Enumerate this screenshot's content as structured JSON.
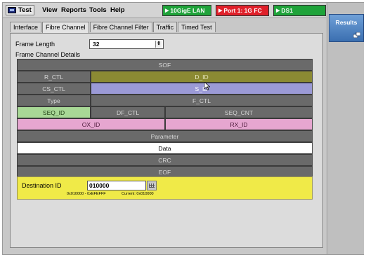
{
  "menu": {
    "test": "Test",
    "view": "View",
    "reports": "Reports",
    "tools": "Tools",
    "help": "Help"
  },
  "status": {
    "lan": "10GigE LAN",
    "port": "Port 1: 1G FC",
    "ds1": "DS1",
    "colors": {
      "green": "#1fa33a",
      "red": "#e0202a"
    }
  },
  "results": {
    "label": "Results"
  },
  "tabs": [
    "Interface",
    "Fibre Channel",
    "Fibre Channel Filter",
    "Traffic",
    "Timed Test"
  ],
  "active_tab": "Fibre Channel",
  "frame_length": {
    "label": "Frame Length",
    "value": "32"
  },
  "details_label": "Frame Channel Details",
  "frame": {
    "sof": "SOF",
    "r_ctl": "R_CTL",
    "d_id": "D_ID",
    "cs_ctl": "CS_CTL",
    "s_id": "S_ID",
    "type": "Type",
    "f_ctl": "F_CTL",
    "seq_id": "SEQ_ID",
    "df_ctl": "DF_CTL",
    "seq_cnt": "SEQ_CNT",
    "ox_id": "OX_ID",
    "rx_id": "RX_ID",
    "parameter": "Parameter",
    "data": "Data",
    "crc": "CRC",
    "eof": "EOF"
  },
  "destination": {
    "label": "Destination ID",
    "value": "010000",
    "range": "0x010000 - 0xEFEFFF",
    "current": "Current: 0x010000"
  }
}
